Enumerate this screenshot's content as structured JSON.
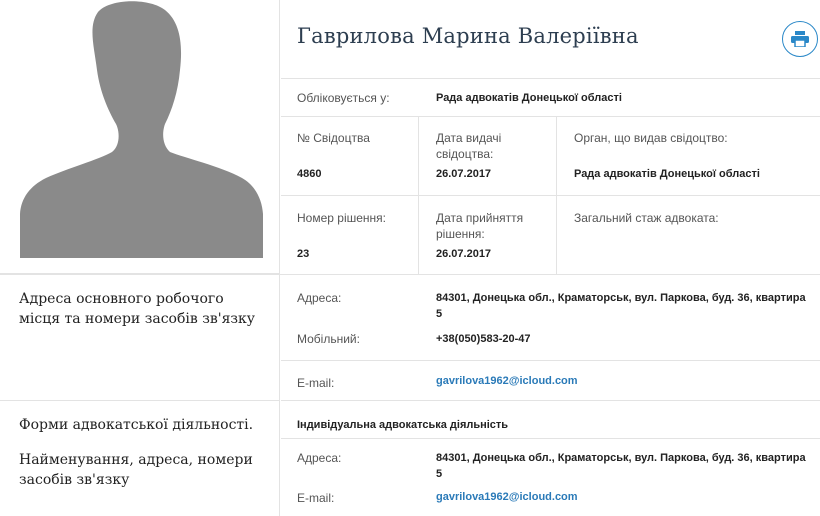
{
  "profile": {
    "name": "Гаврилова Марина Валеріївна",
    "print_icon": "printer-icon",
    "photo_icon": "person-silhouette-icon"
  },
  "registration": {
    "registered_at_label": "Обліковується у:",
    "registered_at_value": "Рада адвокатів Донецької області"
  },
  "certificate": {
    "number_label": "№ Свідоцтва",
    "number_value": "4860",
    "issue_date_label": "Дата видачі свідоцтва:",
    "issue_date_value": "26.07.2017",
    "issuer_label": "Орган, що видав свідоцтво:",
    "issuer_value": "Рада адвокатів Донецької області"
  },
  "decision": {
    "number_label": "Номер рішення:",
    "number_value": "23",
    "date_label": "Дата прийняття рішення:",
    "date_value": "26.07.2017",
    "experience_label": "Загальний стаж адвоката:"
  },
  "workplace": {
    "section_title": "Адреса основного робочого місця та номери засобів зв'язку",
    "address_label": "Адреса:",
    "address_value": "84301, Донецька обл., Краматорськ, вул. Паркова, буд. 36, квартира 5",
    "mobile_label": "Мобільний:",
    "mobile_value": "+38(050)583-20-47",
    "email_label": "E-mail:",
    "email_value": "gavrilova1962@icloud.com"
  },
  "practice": {
    "section_title": "Форми адвокатської діяльності.",
    "section_subtitle": "Найменування, адреса, номери засобів зв'язку",
    "form_value": "Індивідуальна адвокатська діяльність",
    "address_label": "Адреса:",
    "address_value": "84301, Донецька обл., Краматорськ, вул. Паркова, буд. 36, квартира 5",
    "email_label": "E-mail:",
    "email_value": "gavrilova1962@icloud.com"
  },
  "colors": {
    "accent": "#2a88c8",
    "link": "#2a7ab8",
    "silhouette": "#8a8a8a",
    "divider": "#e3e3e3"
  }
}
